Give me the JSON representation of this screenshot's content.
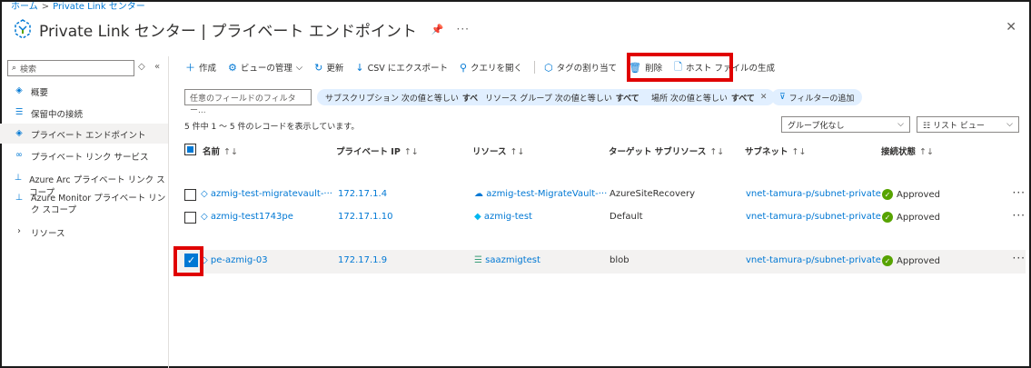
{
  "breadcrumb": {
    "home": "ホーム",
    "current": "Private Link センター"
  },
  "header": {
    "title": "Private Link センター | プライベート エンドポイント",
    "pin_icon": "pin-icon",
    "more": "···",
    "close": "✕"
  },
  "sidebar": {
    "search_placeholder": "検索",
    "items": [
      {
        "label": "概要",
        "icon": "overview-icon"
      },
      {
        "label": "保留中の接続",
        "icon": "list-icon"
      },
      {
        "label": "プライベート エンドポイント",
        "icon": "endpoint-icon"
      },
      {
        "label": "プライベート リンク サービス",
        "icon": "link-service-icon"
      },
      {
        "label": "Azure Arc プライベート リンク スコープ",
        "icon": "arc-scope-icon"
      },
      {
        "label": "Azure Monitor プライベート リンク スコープ",
        "icon": "monitor-scope-icon"
      },
      {
        "label": "リソース",
        "icon": "chevron-right-icon"
      }
    ]
  },
  "toolbar": {
    "create": "作成",
    "view_manage": "ビューの管理",
    "refresh": "更新",
    "export_csv": "CSV にエクスポート",
    "open_query": "クエリを開く",
    "assign_tags": "タグの割り当て",
    "delete": "削除",
    "generate_hosts": "ホスト ファイルの生成"
  },
  "filters": {
    "input_placeholder": "任意のフィールドのフィルター...",
    "subscription_label": "サブスクリプション 次の値と等しい",
    "subscription_value": "すべて",
    "resource_group_label": "リソース グループ 次の値と等しい",
    "resource_group_value": "すべて",
    "location_label": "場所 次の値と等しい",
    "location_value": "すべて",
    "add_filter": "フィルターの追加"
  },
  "records_count": "5 件中 1 ～ 5 件のレコードを表示しています。",
  "grouping": "グループ化なし",
  "view_mode": "リスト ビュー",
  "columns": {
    "name": "名前",
    "private_ip": "プライベート IP",
    "resource": "リソース",
    "target_subresource": "ターゲット サブリソース",
    "subnet": "サブネット",
    "connection_state": "接続状態"
  },
  "rows": [
    {
      "name": "azmig-test-migratevault-···",
      "ip": "172.17.1.4",
      "resource": "azmig-test-MigrateVault-···",
      "target": "AzureSiteRecovery",
      "subnet": "vnet-tamura-p/subnet-private",
      "state": "Approved",
      "checked": false
    },
    {
      "name": "azmig-test1743pe",
      "ip": "172.17.1.10",
      "resource": "azmig-test",
      "target": "Default",
      "subnet": "vnet-tamura-p/subnet-private",
      "state": "Approved",
      "checked": false
    },
    {
      "name": "pe-azmig-03",
      "ip": "172.17.1.9",
      "resource": "saazmigtest",
      "target": "blob",
      "subnet": "vnet-tamura-p/subnet-private",
      "state": "Approved",
      "checked": true
    }
  ],
  "colors": {
    "accent": "#0078d4",
    "highlight": "#e00000",
    "approved": "#57a300"
  }
}
